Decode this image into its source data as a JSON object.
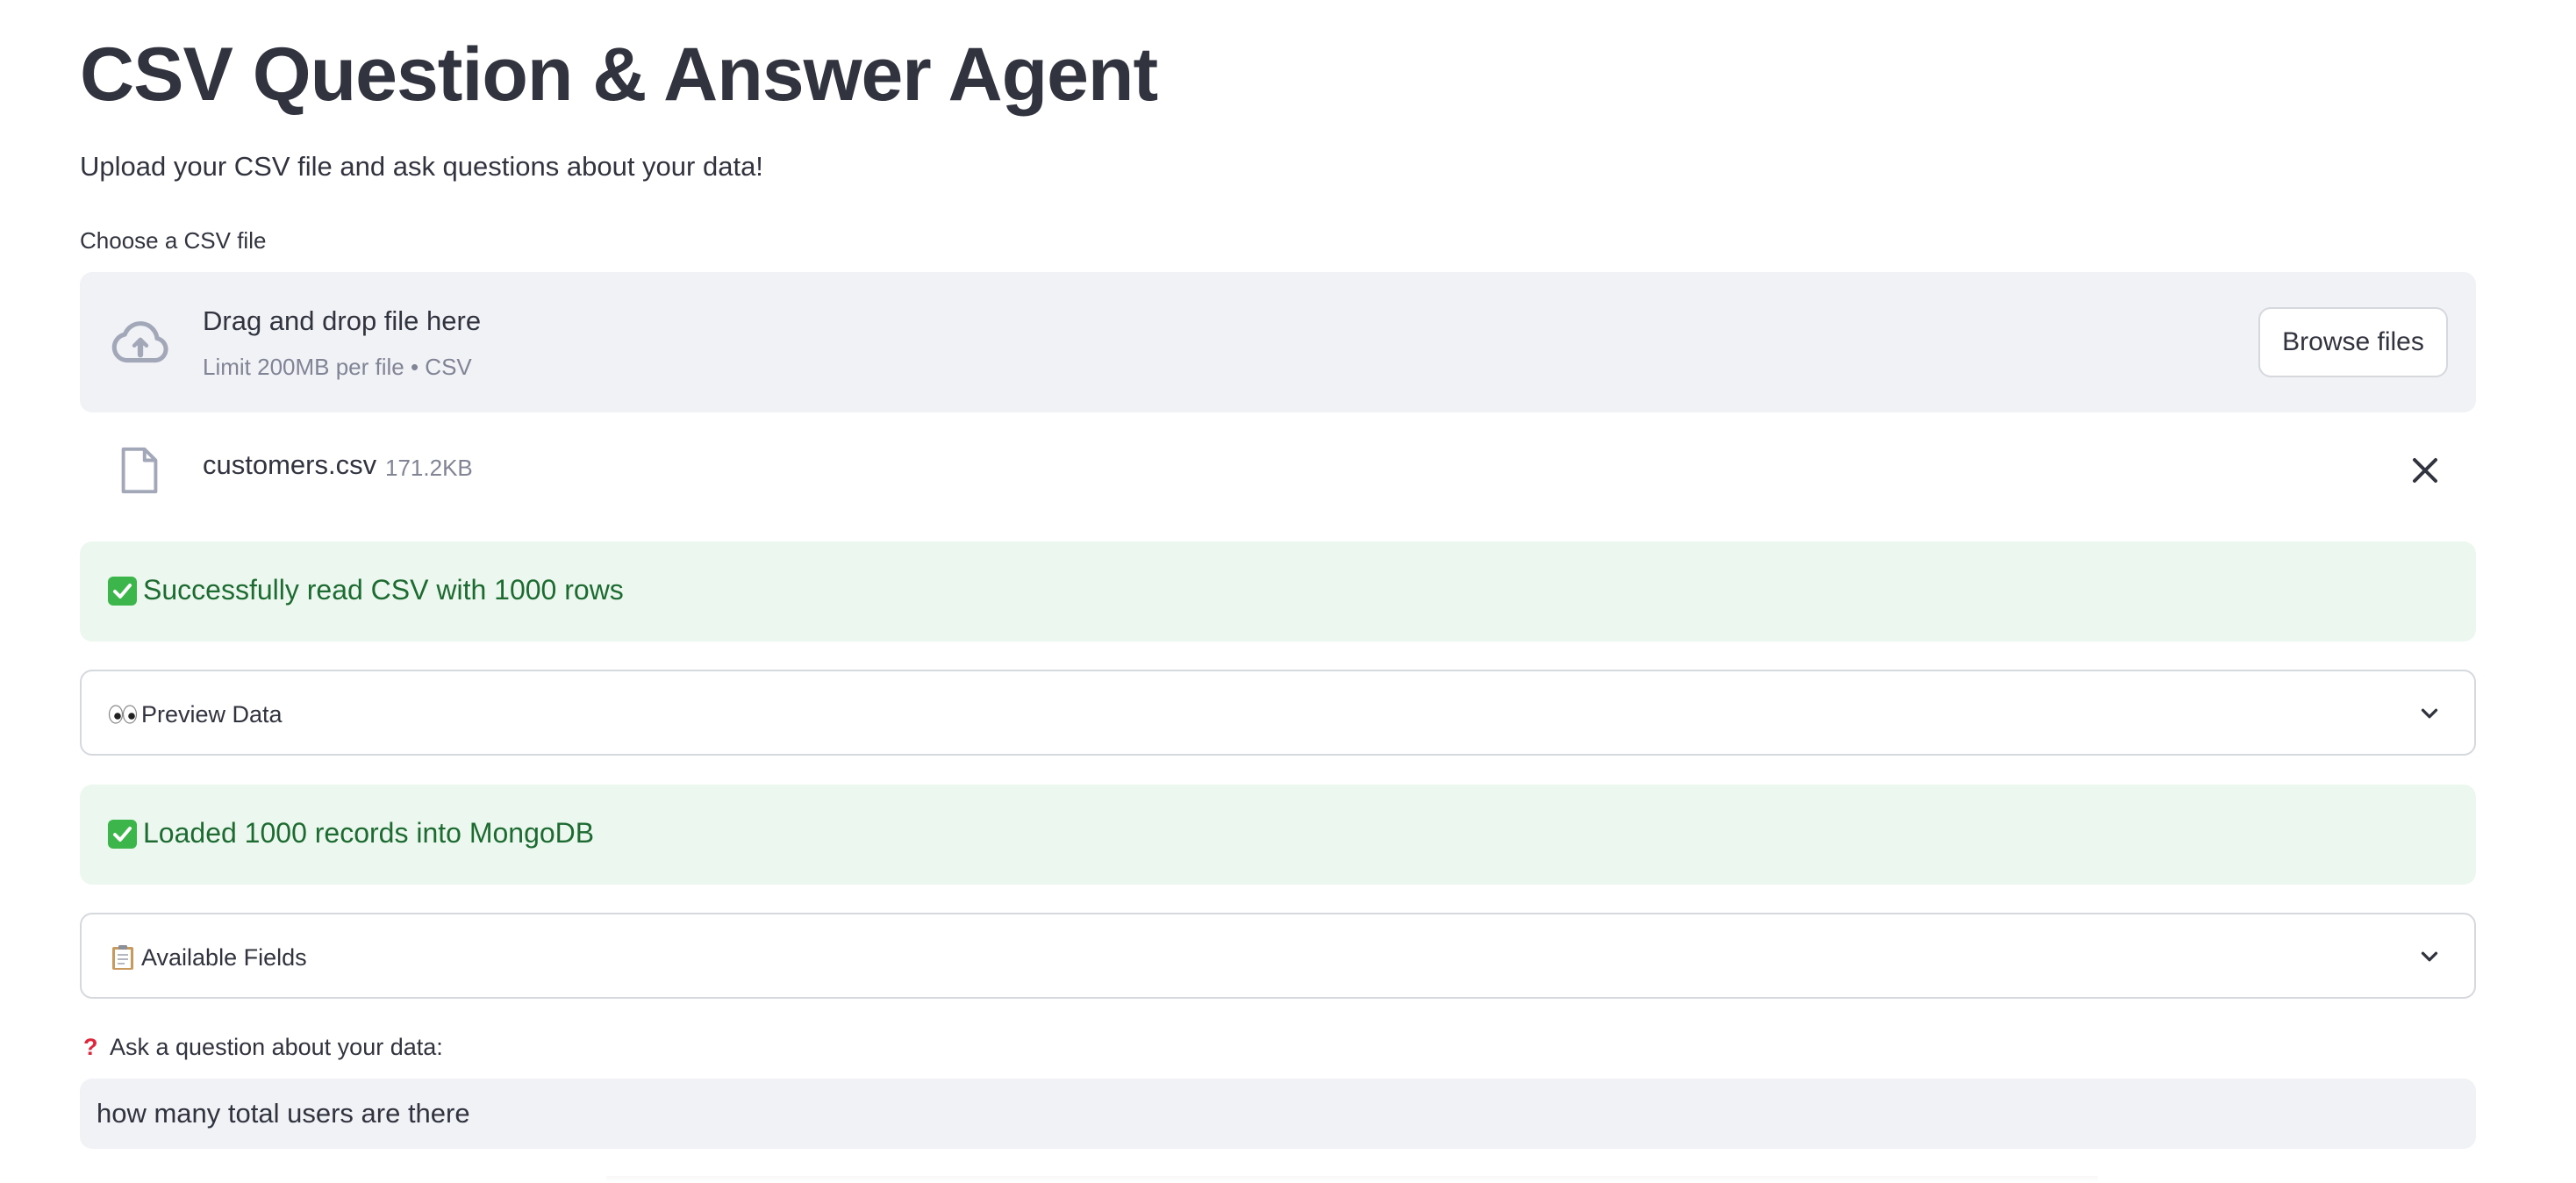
{
  "header": {
    "title": "CSV Question & Answer Agent",
    "subtitle": "Upload your CSV file and ask questions about your data!"
  },
  "uploader": {
    "label": "Choose a CSV file",
    "drop_text": "Drag and drop file here",
    "limit_text": "Limit 200MB per file • CSV",
    "browse_label": "Browse files",
    "upload_icon": "cloud-upload-icon"
  },
  "uploaded_file": {
    "name": "customers.csv",
    "size": "171.2KB",
    "file_icon": "file-icon",
    "remove_icon": "close-icon"
  },
  "alerts": [
    {
      "icon": "check-mark-icon",
      "text": "Successfully read CSV with 1000 rows"
    },
    {
      "icon": "check-mark-icon",
      "text": "Loaded 1000 records into MongoDB"
    }
  ],
  "expanders": [
    {
      "icon": "eyes-icon",
      "label": "Preview Data",
      "expanded": false
    },
    {
      "icon": "clipboard-icon",
      "label": "Available Fields",
      "expanded": false
    }
  ],
  "question": {
    "icon": "question-mark-icon",
    "label": "Ask a question about your data:",
    "value": "how many total users are there"
  },
  "colors": {
    "text": "#31333f",
    "muted": "#808495",
    "panel_bg": "#f0f2f6",
    "success_bg": "#ecf8ef",
    "success_text": "#1e6b32",
    "border": "#d5d8dd",
    "question_mark": "#e0263b"
  }
}
